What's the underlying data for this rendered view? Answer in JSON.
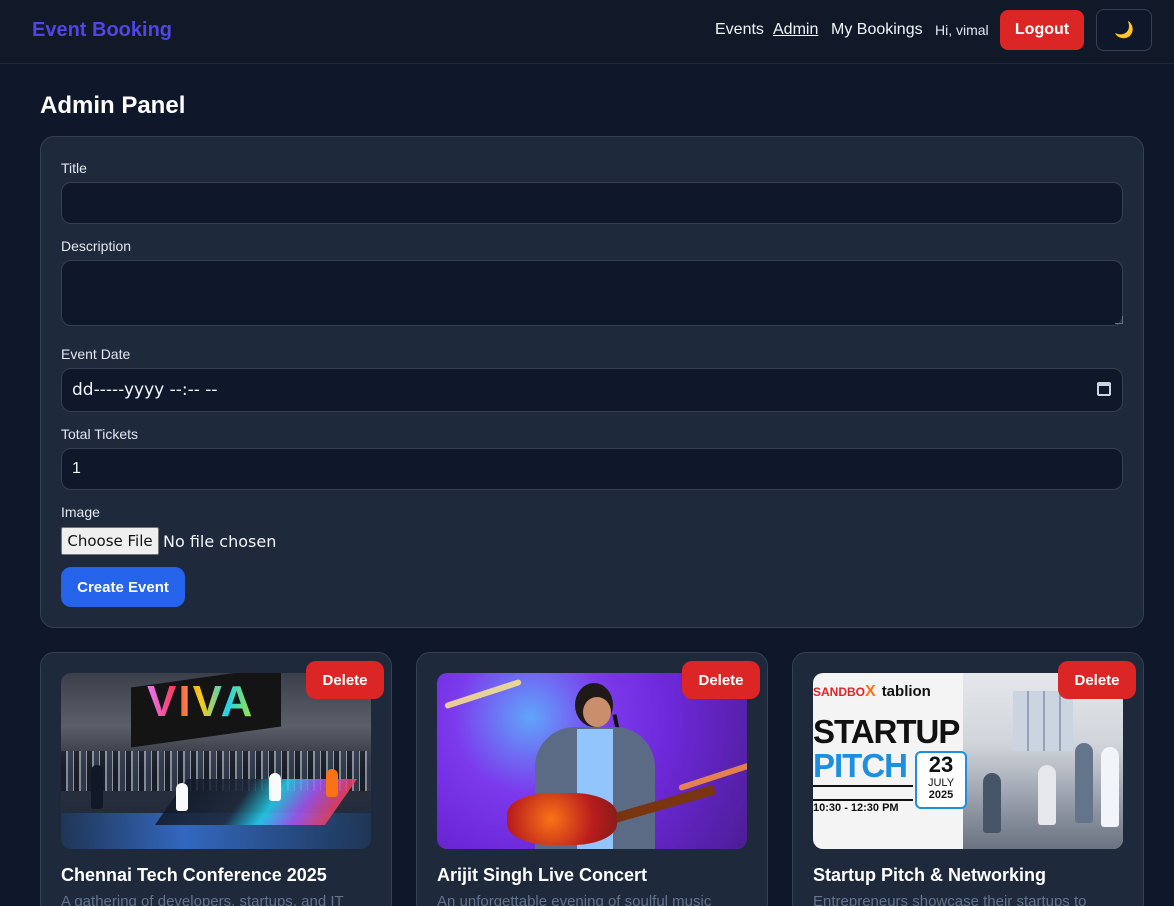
{
  "navbar": {
    "brand": "Event Booking",
    "links": [
      "Events",
      "Admin",
      "My Bookings"
    ],
    "greeting": "Hi, vimal",
    "logout_label": "Logout",
    "theme_icon": "moon-icon",
    "theme_glyph": "🌙"
  },
  "admin": {
    "title": "Admin Panel",
    "form": {
      "title_label": "Title",
      "title_value": "",
      "description_label": "Description",
      "description_value": "",
      "date_label": "Event Date",
      "date_placeholder": "dd-----yyyy --:-- --",
      "tickets_label": "Total Tickets",
      "tickets_value": "1",
      "image_label": "Image",
      "choose_file_label": "Choose File",
      "no_file_text": "No file chosen",
      "create_label": "Create Event"
    }
  },
  "events": [
    {
      "title": "Chennai Tech Conference 2025",
      "description": "A gathering of developers, startups, and IT",
      "delete_label": "Delete",
      "image_text": "VIVA"
    },
    {
      "title": "Arijit Singh Live Concert",
      "description": "An unforgettable evening of soulful music",
      "delete_label": "Delete"
    },
    {
      "title": "Startup Pitch & Networking",
      "description": "Entrepreneurs showcase their startups to",
      "delete_label": "Delete",
      "image_text": {
        "brand1": "SANDBO",
        "brand_x": "X",
        "brand2": "tablion",
        "headline1": "STARTUP",
        "headline2": "PITCH",
        "day": "23",
        "month": "JULY",
        "year": "2025",
        "time": "10:30 - 12:30 PM"
      }
    }
  ],
  "colors": {
    "background": "#0f172a",
    "brand": "#4f46e5",
    "danger": "#dc2626",
    "primary": "#2563eb",
    "card": "#1e293b"
  }
}
